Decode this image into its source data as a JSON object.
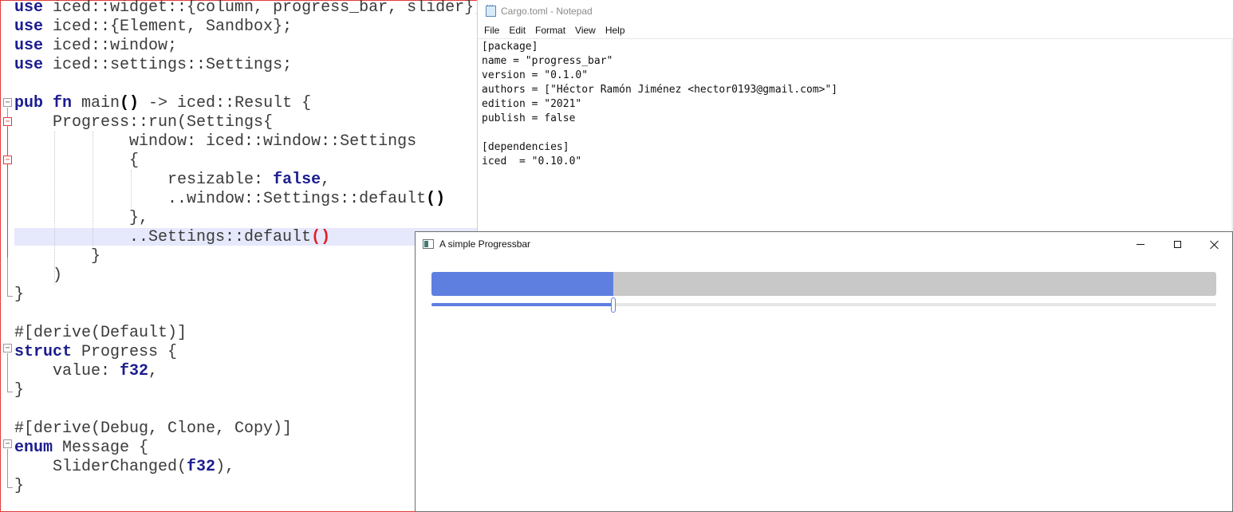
{
  "editor": {
    "lines": [
      [
        "use",
        " iced::widget::{column, progress_bar, slider};"
      ],
      [
        "use",
        " iced::{Element, Sandbox};"
      ],
      [
        "use",
        " iced::window;"
      ],
      [
        "use",
        " iced::settings::Settings;"
      ],
      [
        ""
      ],
      [
        "pub fn",
        " main",
        "()",
        " -> iced::Result {"
      ],
      [
        "    Progress::run(Settings{"
      ],
      [
        "            window: iced::window::Settings"
      ],
      [
        "            {"
      ],
      [
        "                resizable: ",
        "false",
        ","
      ],
      [
        "                ..window::Settings::default",
        "()"
      ],
      [
        "            },"
      ],
      [
        "            ..Settings::default",
        "()"
      ],
      [
        "        }"
      ],
      [
        "    )"
      ],
      [
        "}"
      ],
      [
        ""
      ],
      [
        "#[derive(Default)]"
      ],
      [
        "struct",
        " Progress {"
      ],
      [
        "    value: ",
        "f32",
        ","
      ],
      [
        "}"
      ],
      [
        ""
      ],
      [
        "#[derive(Debug, Clone, Copy)]"
      ],
      [
        "enum",
        " Message {"
      ],
      [
        "    SliderChanged(",
        "f32",
        "),"
      ],
      [
        "}"
      ]
    ]
  },
  "notepad": {
    "title": "Cargo.toml - Notepad",
    "menu": [
      "File",
      "Edit",
      "Format",
      "View",
      "Help"
    ],
    "lines": [
      "[package]",
      "name = \"progress_bar\"",
      "version = \"0.1.0\"",
      "authors = [\"Héctor Ramón Jiménez <hector0193@gmail.com>\"]",
      "edition = \"2021\"",
      "publish = false",
      "",
      "[dependencies]",
      "iced  = \"0.10.0\""
    ]
  },
  "app": {
    "title": "A simple Progressbar",
    "progress_value": 0.232,
    "slider_value": 0.232,
    "colors": {
      "accent": "#5f7fe0",
      "track": "#c8c8c8"
    }
  }
}
